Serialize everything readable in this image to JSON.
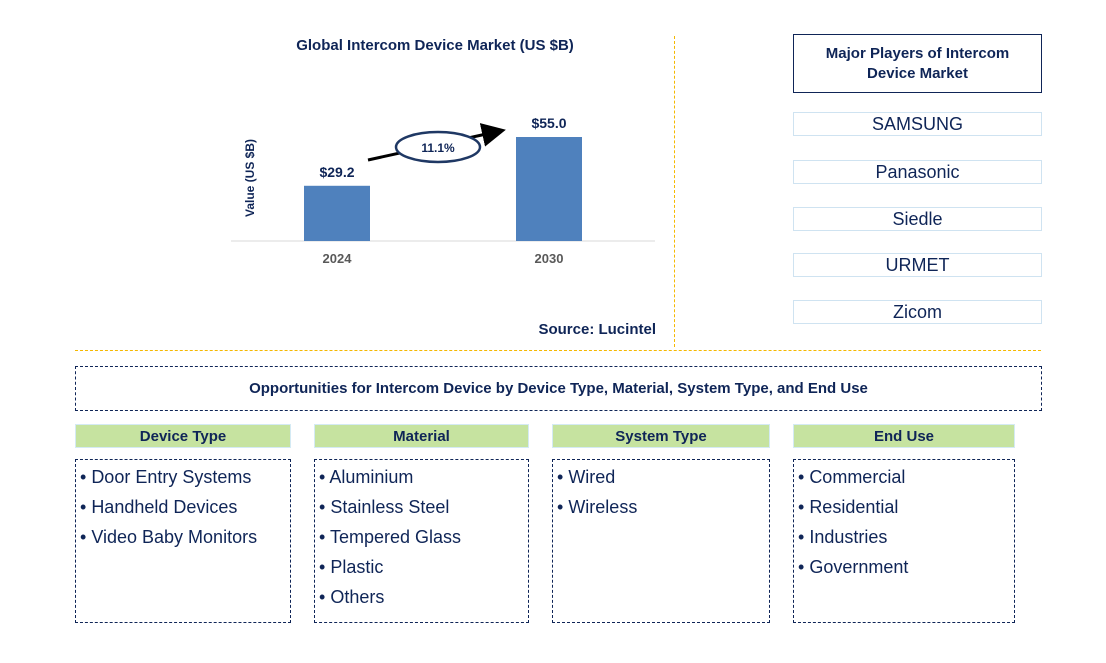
{
  "chart_data": {
    "type": "bar",
    "title": "Global Intercom Device Market (US $B)",
    "xlabel": "",
    "ylabel": "Value (US $B)",
    "categories": [
      "2024",
      "2030"
    ],
    "values": [
      29.2,
      55.0
    ],
    "data_labels": [
      "$29.2",
      "$55.0"
    ],
    "ylim": [
      0,
      60
    ],
    "grid": false,
    "bar_color": "#4f81bd",
    "annotation": {
      "type": "cagr-arrow",
      "label": "11.1%"
    },
    "source": "Source: Lucintel"
  },
  "players": {
    "title": "Major Players of Intercom Device Market",
    "items": [
      "SAMSUNG",
      "Panasonic",
      "Siedle",
      "URMET",
      "Zicom"
    ]
  },
  "opportunities": {
    "title": "Opportunities for Intercom Device by Device Type, Material, System Type, and End Use",
    "segments": [
      {
        "name": "Device Type",
        "items": [
          "Door Entry Systems",
          "Handheld Devices",
          "Video Baby Monitors"
        ]
      },
      {
        "name": "Material",
        "items": [
          "Aluminium",
          "Stainless Steel",
          "Tempered Glass",
          "Plastic",
          "Others"
        ]
      },
      {
        "name": "System Type",
        "items": [
          "Wired",
          "Wireless"
        ]
      },
      {
        "name": "End Use",
        "items": [
          "Commercial",
          "Residential",
          "Industries",
          "Government"
        ]
      }
    ]
  },
  "colors": {
    "text": "#0f2557",
    "bar": "#4f81bd",
    "divider": "#f5b800",
    "segment_header": "#c6e3a0"
  }
}
